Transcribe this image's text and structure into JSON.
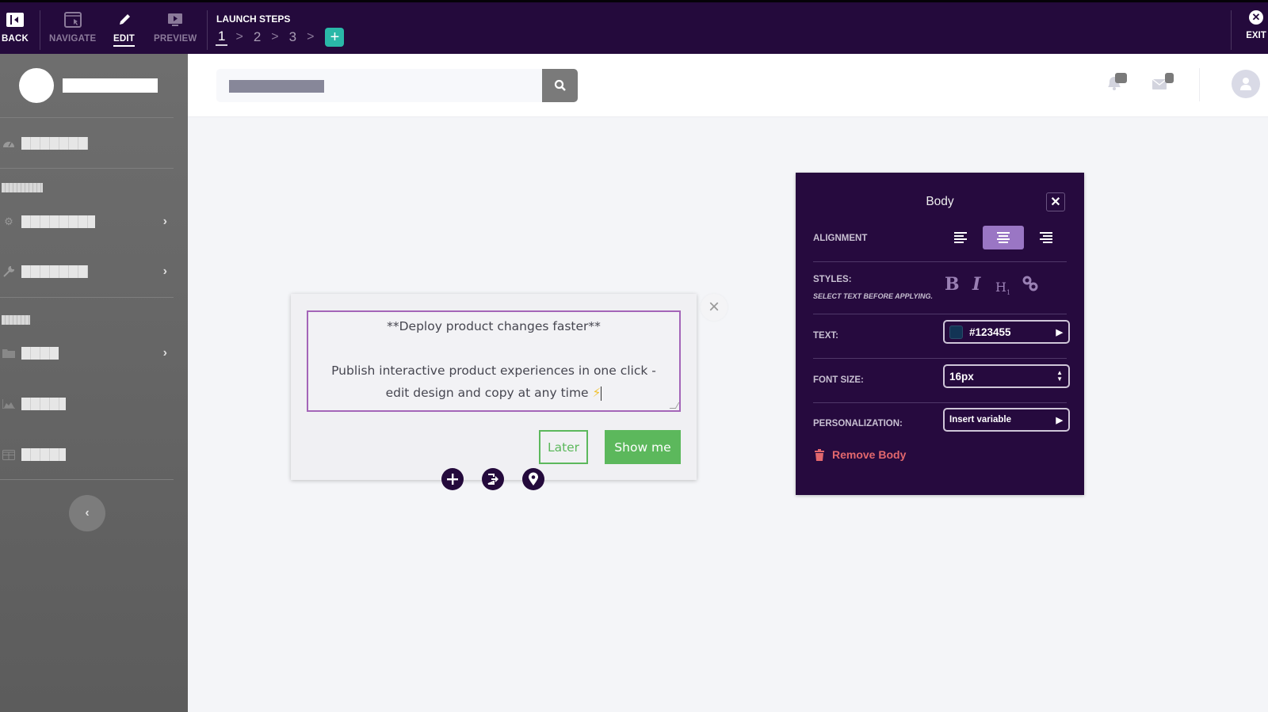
{
  "topbar": {
    "back_label": "BACK",
    "navigate_label": "NAVIGATE",
    "edit_label": "EDIT",
    "preview_label": "PREVIEW",
    "launch_steps_title": "LAUNCH STEPS",
    "steps": [
      "1",
      "2",
      "3"
    ],
    "active_step": "1",
    "add_step_icon": "+",
    "exit_label": "EXIT"
  },
  "header": {
    "search_placeholder": "",
    "search_button_icon": "search-icon"
  },
  "sidebar": {
    "items": [
      {
        "icon": "dashboard-icon",
        "has_arrow": false
      },
      {
        "icon": "gear-icon",
        "has_arrow": true
      },
      {
        "icon": "wrench-icon",
        "has_arrow": true
      },
      {
        "icon": "folder-icon",
        "has_arrow": true
      },
      {
        "icon": "chart-icon",
        "has_arrow": false
      },
      {
        "icon": "table-icon",
        "has_arrow": false
      }
    ],
    "collapse_icon": "‹",
    "arrow_glyph": "›"
  },
  "tooltip": {
    "title_line": "**Deploy product changes faster**",
    "body_line1": "Publish interactive product experiences in one click -",
    "body_line2": "edit design and copy at any time",
    "emoji": "⚡",
    "later_label": "Later",
    "show_me_label": "Show me",
    "close_glyph": "×",
    "colors": {
      "button_green": "#5cb85c",
      "editor_border": "#a465b8"
    }
  },
  "panel": {
    "title": "Body",
    "close_glyph": "✕",
    "alignment_label": "ALIGNMENT",
    "alignment_selected": "center",
    "styles_label": "STYLES:",
    "styles_hint": "SELECT TEXT BEFORE APPLYING.",
    "style_bold": "B",
    "style_italic": "I",
    "style_heading": "H",
    "style_heading_sub": "1",
    "text_label": "TEXT:",
    "text_color_value": "#123455",
    "font_size_label": "FONT SIZE:",
    "font_size_value": "16px",
    "personalization_label": "PERSONALIZATION:",
    "personalization_value": "Insert variable",
    "remove_label": "Remove Body",
    "colors": {
      "background": "#260a3e",
      "accent": "#9a76c4",
      "danger": "#e2676d"
    }
  }
}
